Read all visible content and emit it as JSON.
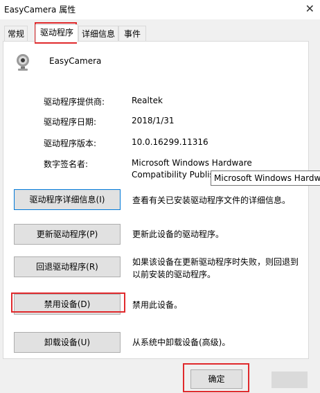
{
  "window": {
    "title": "EasyCamera 属性",
    "close_icon": "close-icon"
  },
  "tabs": [
    {
      "label": "常规"
    },
    {
      "label": "驱动程序"
    },
    {
      "label": "详细信息"
    },
    {
      "label": "事件"
    }
  ],
  "device": {
    "icon": "webcam-icon",
    "name": "EasyCamera"
  },
  "driver_info": {
    "provider_label": "驱动程序提供商:",
    "provider_value": "Realtek",
    "date_label": "驱动程序日期:",
    "date_value": "2018/1/31",
    "version_label": "驱动程序版本:",
    "version_value": "10.0.16299.11316",
    "signer_label": "数字签名者:",
    "signer_value_line1": "Microsoft Windows Hardware",
    "signer_value_line2": "Compatibility Publis"
  },
  "tooltip": {
    "text": "Microsoft Windows Hardware"
  },
  "actions": {
    "details_button": "驱动程序详细信息(I)",
    "details_desc": "查看有关已安装驱动程序文件的详细信息。",
    "update_button": "更新驱动程序(P)",
    "update_desc": "更新此设备的驱动程序。",
    "rollback_button": "回退驱动程序(R)",
    "rollback_desc_line1": "如果该设备在更新驱动程序时失败，则回退到",
    "rollback_desc_line2": "以前安装的驱动程序。",
    "disable_button": "禁用设备(D)",
    "disable_desc": "禁用此设备。",
    "uninstall_button": "卸载设备(U)",
    "uninstall_desc": "从系统中卸载设备(高级)。"
  },
  "footer": {
    "ok_button": "确定"
  },
  "colors": {
    "highlight": "#e0292c",
    "focus_border": "#0078d7"
  }
}
